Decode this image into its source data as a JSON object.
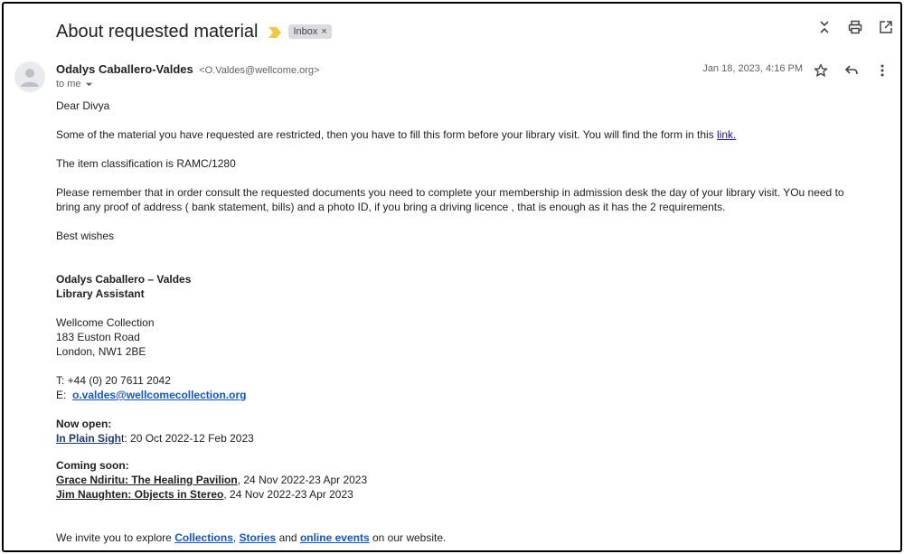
{
  "email": {
    "subject": "About requested material",
    "label": "Inbox",
    "label_close": "×",
    "sender_name": "Odalys Caballero-Valdes",
    "sender_email": "<O.Valdes@wellcome.org>",
    "to": "to me",
    "date": "Jan 18, 2023, 4:16 PM"
  },
  "body": {
    "greeting": "Dear Divya",
    "para1": "Some of the material you have requested  are restricted, then you have to fill this form before your library visit. You will find the form in this ",
    "para1_link": "link.",
    "para2": "The item classification is RAMC/1280",
    "para3": "Please remember that in order consult the requested documents you need to complete your membership in admission desk the day of your library visit. YOu need to bring  any proof of address ( bank statement, bills) and a photo ID, if you bring a driving licence , that is enough  as it has the 2 requirements.",
    "closing": "Best wishes"
  },
  "signature": {
    "name": "Odalys Caballero – Valdes",
    "role": "Library Assistant",
    "org": "Wellcome Collection",
    "address1": "183 Euston Road",
    "address2": "London, NW1 2BE",
    "phone": "T: +44 (0) 20 7611 2042",
    "email_prefix": "E:  ",
    "email": "o.valdes@wellcomecollection.org",
    "now_open_heading": "Now open:",
    "now_open_link": "In Plain Sigh",
    "now_open_link_tail": "t",
    "now_open_dates": ": 20 Oct 2022-12 Feb 2023",
    "coming_soon_heading": "Coming soon:",
    "coming1_link": "Grace Ndiritu: The Healing Pavilion",
    "coming1_dates": ", 24 Nov 2022-23 Apr 2023",
    "coming2_link": "Jim Naughten: Objects in Stereo",
    "coming2_dates": ", 24 Nov 2022-23 Apr 2023",
    "invite_pre": "We invite you to explore ",
    "invite_link1": "Collections",
    "invite_sep1": ", ",
    "invite_link2": "Stories",
    "invite_mid": " and ",
    "invite_link3": "online events",
    "invite_post": " on our website."
  },
  "icons": {
    "importance": "importance-marker-icon",
    "expand": "expand-collapse-icon",
    "print": "print-icon",
    "open_new": "open-in-new-window-icon",
    "star": "star-icon",
    "reply": "reply-icon",
    "more": "more-vertical-icon",
    "avatar": "avatar-person-icon",
    "dropdown": "chevron-down-icon"
  },
  "colors": {
    "importance": "#f2c744",
    "link": "#1155cc",
    "muted": "#5f6368",
    "chip": "#dadce0"
  }
}
